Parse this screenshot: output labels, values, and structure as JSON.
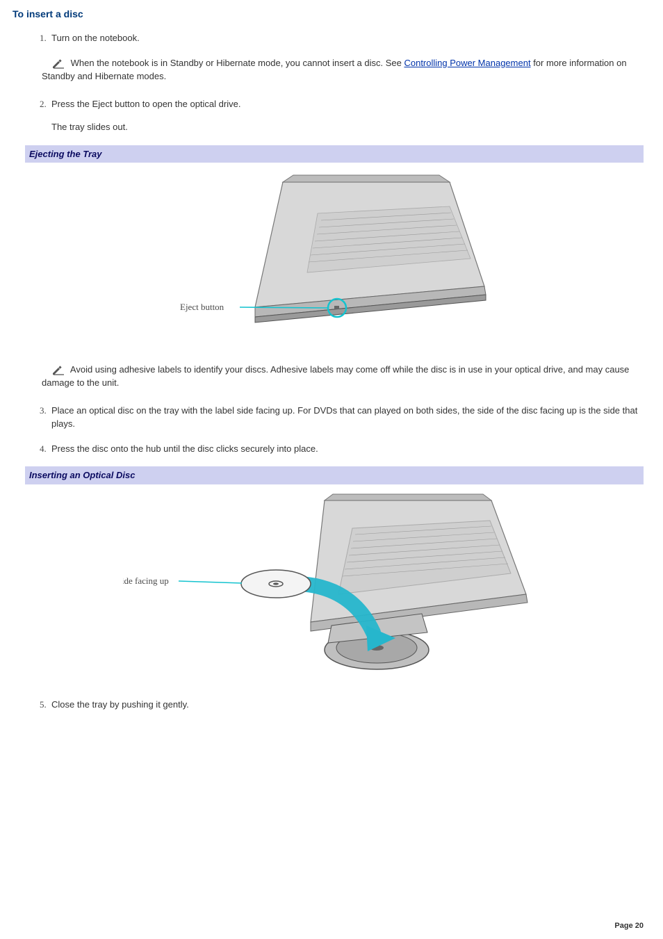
{
  "heading": "To insert a disc",
  "steps": {
    "s1": "Turn on the notebook.",
    "note1_a": "When the notebook is in Standby or Hibernate mode, you cannot insert a disc. See ",
    "note1_link": "Controlling Power Management",
    "note1_b": " for more information on Standby and Hibernate modes.",
    "s2": "Press the Eject button to open the optical drive.",
    "s2_sub": "The tray slides out.",
    "note2": "Avoid using adhesive labels to identify your discs. Adhesive labels may come off while the disc is in use in your optical drive, and may cause damage to the unit.",
    "s3": "Place an optical disc on the tray with the label side facing up. For DVDs that can played on both sides, the side of the disc facing up is the side that plays.",
    "s4": "Press the disc onto the hub until the disc clicks securely into place.",
    "s5": "Close the tray by pushing it gently."
  },
  "banners": {
    "b1": "Ejecting the Tray",
    "b2": "Inserting an Optical Disc"
  },
  "figures": {
    "f1_label": "Eject button",
    "f2_label": "Label side facing up"
  },
  "footer": "Page 20"
}
